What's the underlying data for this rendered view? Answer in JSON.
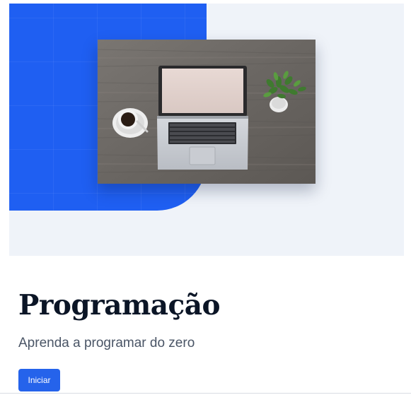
{
  "course": {
    "title": "Programação",
    "subtitle": "Aprenda a programar do zero",
    "start_label": "Iniciar"
  },
  "colors": {
    "accent_blue": "#1f5ff2",
    "button_blue": "#2563eb",
    "hero_background": "#eff3f9",
    "title_text": "#0b1526",
    "subtitle_text": "#4a5566"
  },
  "hero_image": {
    "icon": "laptop-coffee-plant-photo"
  }
}
